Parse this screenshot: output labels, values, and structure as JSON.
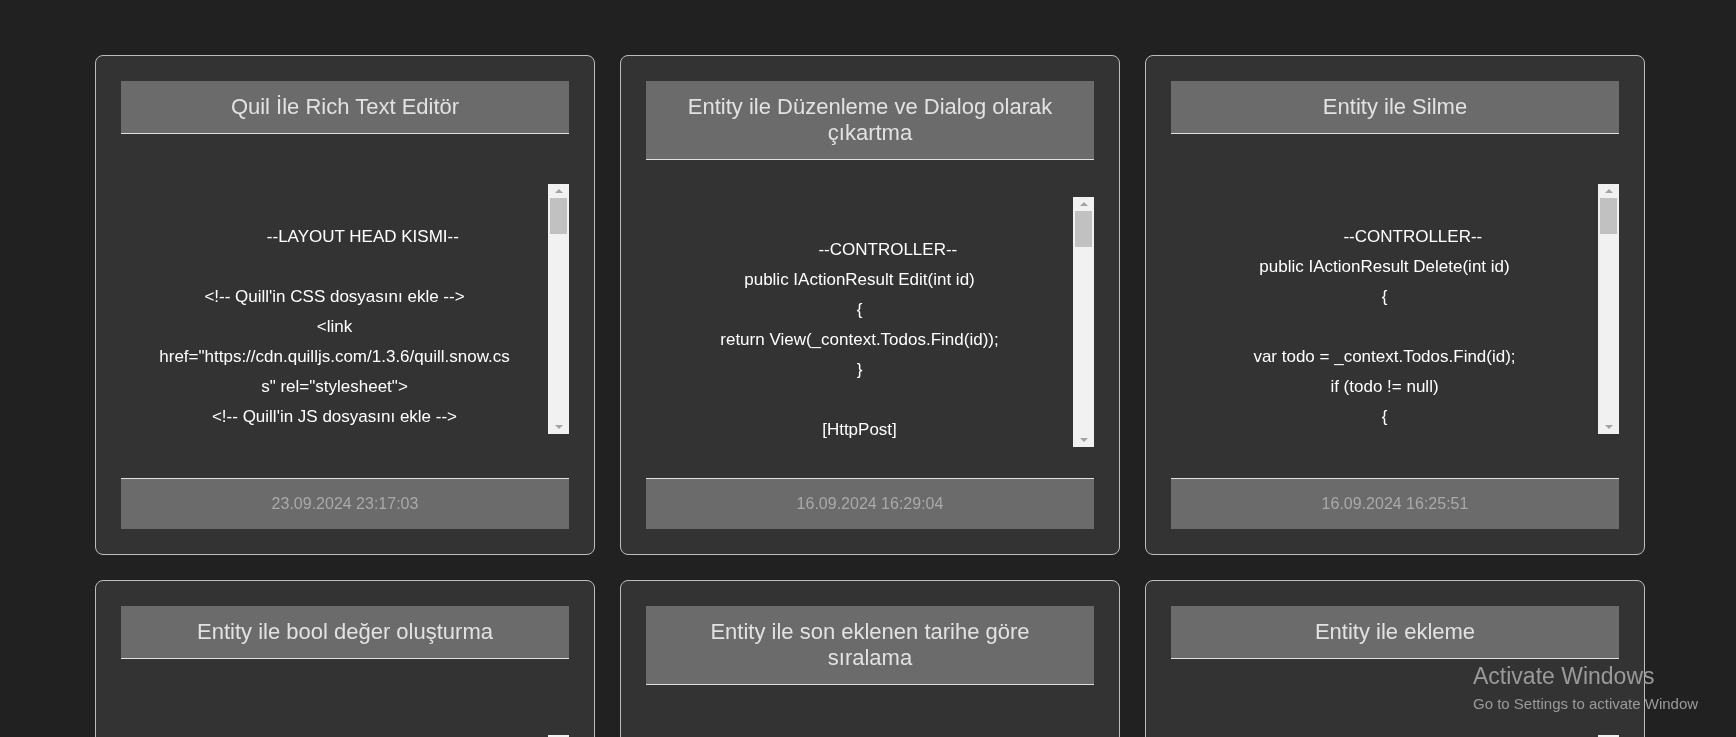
{
  "cards": [
    {
      "title": "Quil İle Rich Text Editör",
      "code": "            --LAYOUT HEAD KISMI--\n\n<!-- Quill'in CSS dosyasını ekle -->\n<link href=\"https://cdn.quilljs.com/1.3.6/quill.snow.css\" rel=\"stylesheet\">\n<!-- Quill'in JS dosyasını ekle -->",
      "date": "23.09.2024 23:17:03"
    },
    {
      "title": "Entity ile Düzenleme ve Dialog olarak çıkartma",
      "code": "            --CONTROLLER--\npublic IActionResult Edit(int id)\n{\nreturn View(_context.Todos.Find(id));\n}\n\n[HttpPost]",
      "date": "16.09.2024 16:29:04"
    },
    {
      "title": "Entity ile Silme",
      "code": "            --CONTROLLER--\npublic IActionResult Delete(int id)\n{\n\nvar todo = _context.Todos.Find(id);\nif (todo != null)\n{",
      "date": "16.09.2024 16:25:51"
    },
    {
      "title": "Entity ile bool değer oluşturma"
    },
    {
      "title": "Entity ile son eklenen tarihe göre sıralama"
    },
    {
      "title": "Entity ile ekleme"
    }
  ],
  "os_overlay": {
    "title": "Activate Windows",
    "subtitle": "Go to Settings to activate Window"
  }
}
